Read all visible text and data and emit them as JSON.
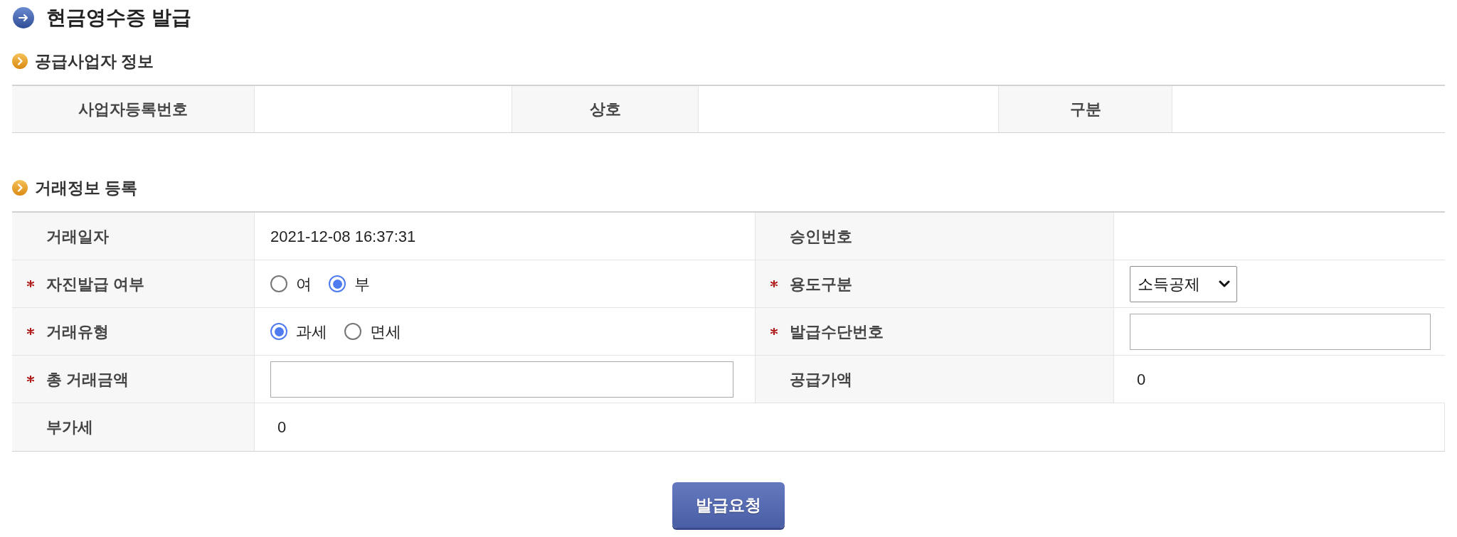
{
  "title": "현금영수증 발급",
  "supplier_info": {
    "title": "공급사업자 정보",
    "fields": [
      {
        "label": "사업자등록번호"
      },
      {
        "label": "상호"
      },
      {
        "label": "구분"
      }
    ]
  },
  "transaction_info": {
    "title": "거래정보 등록",
    "rows": [
      {
        "fields": [
          {
            "label": "거래일자",
            "required": false,
            "kind": "text",
            "value": "2021-12-08 16:37:31"
          },
          {
            "label": "승인번호",
            "required": false,
            "kind": "text"
          }
        ]
      },
      {
        "fields": [
          {
            "label": "자진발급 여부",
            "required": true,
            "kind": "radio",
            "options": [
              {
                "label": "여",
                "selected": false
              },
              {
                "label": "부",
                "selected": true
              }
            ]
          },
          {
            "label": "용도구분",
            "required": true,
            "kind": "select",
            "value": "소득공제"
          }
        ]
      },
      {
        "fields": [
          {
            "label": "거래유형",
            "required": true,
            "kind": "radio",
            "options": [
              {
                "label": "과세",
                "selected": true
              },
              {
                "label": "면세",
                "selected": false
              }
            ]
          },
          {
            "label": "발급수단번호",
            "required": true,
            "kind": "input"
          }
        ]
      },
      {
        "fields": [
          {
            "label": "총 거래금액",
            "required": true,
            "kind": "input"
          },
          {
            "label": "공급가액",
            "required": false,
            "kind": "amount",
            "value": "0"
          }
        ]
      },
      {
        "fields": [
          {
            "label": "부가세",
            "required": false,
            "kind": "amount",
            "value": "0"
          }
        ]
      }
    ]
  },
  "submit_button": "발급요청"
}
